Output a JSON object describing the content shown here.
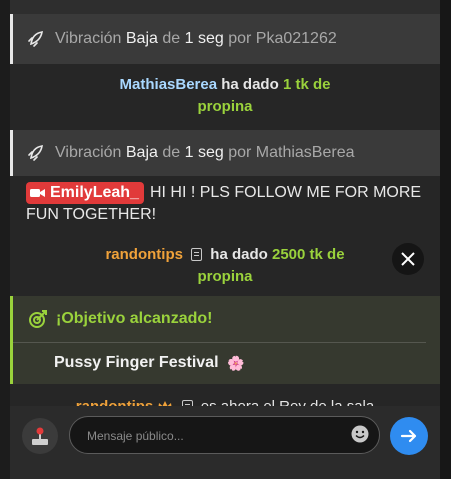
{
  "chat": {
    "vibe1": {
      "prefix": "Vibración",
      "level": "Baja",
      "de": "de",
      "duration": "1 seg",
      "por": "por",
      "user": "Pka021262"
    },
    "tip1": {
      "user": "MathiasBerea",
      "text": "ha dado",
      "amount": "1 tk de",
      "amount2": "propina"
    },
    "vibe2": {
      "prefix": "Vibración",
      "level": "Baja",
      "de": "de",
      "duration": "1 seg",
      "por": "por",
      "user": "MathiasBerea"
    },
    "model_msg": {
      "user": "EmilyLeah_",
      "text": "HI HI ! PLS FOLLOW ME FOR MORE FUN TOGETHER!"
    },
    "tip2": {
      "user": "randontips",
      "text": "ha dado",
      "amount": "2500 tk de",
      "amount2": "propina"
    },
    "goal": {
      "heading": "¡Objetivo alcanzado!",
      "title": "Pussy Finger Festival",
      "emoji": "🌸"
    },
    "king": {
      "user": "randontips",
      "text": "es ahora el Rey de la sala"
    }
  },
  "composer": {
    "placeholder": "Mensaje público..."
  },
  "colors": {
    "accent_green": "#9ad23c",
    "send_blue": "#2f8cf0",
    "model_badge": "#e13a3a"
  },
  "icons": [
    "vibration-icon",
    "camera-icon",
    "x-icon",
    "target-icon",
    "crown-icon",
    "emoji-icon",
    "send-icon",
    "joystick-icon"
  ]
}
